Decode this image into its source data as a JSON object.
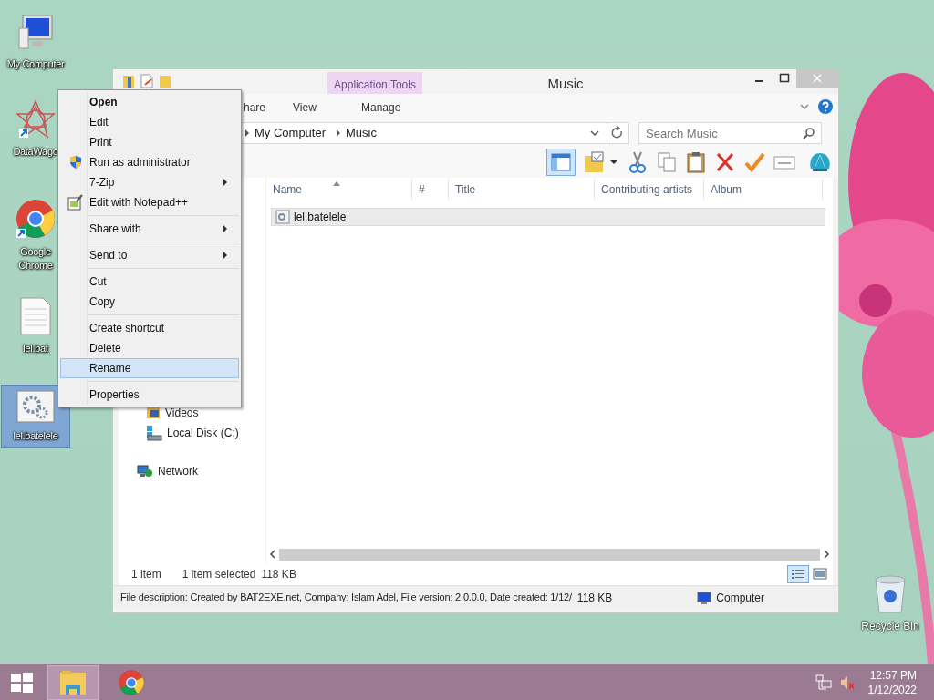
{
  "desktop_icons": [
    {
      "label": "My Computer",
      "kind": "computer",
      "selected": false
    },
    {
      "label": "DataWago",
      "kind": "star",
      "selected": false
    },
    {
      "label": "Google Chrome",
      "kind": "browser",
      "selected": false
    },
    {
      "label": "lel.bat",
      "kind": "document",
      "selected": false
    },
    {
      "label": "lel.batelele",
      "kind": "program",
      "selected": true
    }
  ],
  "recycle_bin": {
    "label": "Recycle Bin"
  },
  "window": {
    "title": "Music",
    "contextual_group": "Application Tools",
    "ribbon_tabs": [
      {
        "label": "hare",
        "selected": false
      },
      {
        "label": "View",
        "selected": false
      },
      {
        "label": "Manage",
        "selected": false
      }
    ],
    "breadcrumb": [
      "My Computer",
      "Music"
    ],
    "search": {
      "placeholder": "Search Music"
    },
    "columns": [
      "Name",
      "#",
      "Title",
      "Contributing artists",
      "Album"
    ],
    "files": [
      {
        "name": "lel.batelele",
        "selected": true
      }
    ],
    "nav_items": [
      {
        "label": "Videos",
        "kind": "videos"
      },
      {
        "label": "Local Disk (C:)",
        "kind": "disk"
      },
      {
        "label": "Network",
        "kind": "network"
      }
    ],
    "status": {
      "count": "1 item",
      "selection": "1 item selected",
      "size": "118 KB"
    },
    "details": {
      "description": "File description: Created by BAT2EXE.net, Company: Islam Adel, File version: 2.0.0.0, Date created: 1/12/",
      "size": "118 KB",
      "location": "Computer"
    }
  },
  "context_menu": {
    "groups": [
      [
        {
          "label": "Open",
          "default": true,
          "kind": "plain",
          "submenu": false,
          "selected": false
        },
        {
          "label": "Edit",
          "default": false,
          "kind": "plain",
          "submenu": false,
          "selected": false
        },
        {
          "label": "Print",
          "default": false,
          "kind": "plain",
          "submenu": false,
          "selected": false
        },
        {
          "label": "Run as administrator",
          "default": false,
          "kind": "elevated",
          "submenu": false,
          "selected": false
        },
        {
          "label": "7-Zip",
          "default": false,
          "kind": "plain",
          "submenu": true,
          "selected": false
        },
        {
          "label": "Edit with Notepad++",
          "default": false,
          "kind": "editor",
          "submenu": false,
          "selected": false
        }
      ],
      [
        {
          "label": "Share with",
          "default": false,
          "kind": "plain",
          "submenu": true,
          "selected": false
        }
      ],
      [
        {
          "label": "Send to",
          "default": false,
          "kind": "plain",
          "submenu": true,
          "selected": false
        }
      ],
      [
        {
          "label": "Cut",
          "default": false,
          "kind": "plain",
          "submenu": false,
          "selected": false
        },
        {
          "label": "Copy",
          "default": false,
          "kind": "plain",
          "submenu": false,
          "selected": false
        }
      ],
      [
        {
          "label": "Create shortcut",
          "default": false,
          "kind": "plain",
          "submenu": false,
          "selected": false
        },
        {
          "label": "Delete",
          "default": false,
          "kind": "plain",
          "submenu": false,
          "selected": false
        },
        {
          "label": "Rename",
          "default": false,
          "kind": "plain",
          "submenu": false,
          "selected": true
        }
      ],
      [
        {
          "label": "Properties",
          "default": false,
          "kind": "plain",
          "submenu": false,
          "selected": false
        }
      ]
    ]
  },
  "taskbar": {
    "apps": [
      {
        "kind": "explorer",
        "selected": true
      },
      {
        "kind": "browser",
        "selected": false
      }
    ],
    "time": "12:57 PM",
    "date": "1/12/2022"
  }
}
